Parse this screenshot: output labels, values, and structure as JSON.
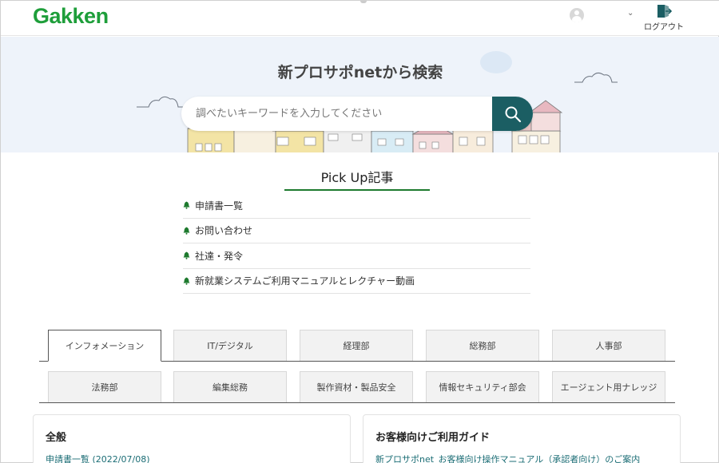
{
  "header": {
    "logo": "Gakken",
    "logout_label": "ログアウト"
  },
  "hero": {
    "title": "新プロサポnetから検索",
    "search_placeholder": "調べたいキーワードを入力してください"
  },
  "pickup": {
    "title": "Pick Up記事",
    "items": [
      {
        "label": "申請書一覧"
      },
      {
        "label": "お問い合わせ"
      },
      {
        "label": "社達・発令"
      },
      {
        "label": "新就業システムご利用マニュアルとレクチャー動画"
      }
    ]
  },
  "tabs": {
    "row1": [
      {
        "label": "インフォメーション"
      },
      {
        "label": "IT/デジタル"
      },
      {
        "label": "経理部"
      },
      {
        "label": "総務部"
      },
      {
        "label": "人事部"
      }
    ],
    "row2": [
      {
        "label": "法務部"
      },
      {
        "label": "編集総務"
      },
      {
        "label": "製作資材・製品安全"
      },
      {
        "label": "情報セキュリティ部会"
      },
      {
        "label": "エージェント用ナレッジ"
      }
    ]
  },
  "cards": [
    {
      "title": "全般",
      "link": "申請書一覧 (2022/07/08)"
    },
    {
      "title": "お客様向けご利用ガイド",
      "link": "新プロサポnet_お客様向け操作マニュアル（承認者向け）のご案内"
    }
  ],
  "colors": {
    "brand_green": "#1e9e3a",
    "search_button": "#1b5e63",
    "link": "#1b6d75"
  }
}
